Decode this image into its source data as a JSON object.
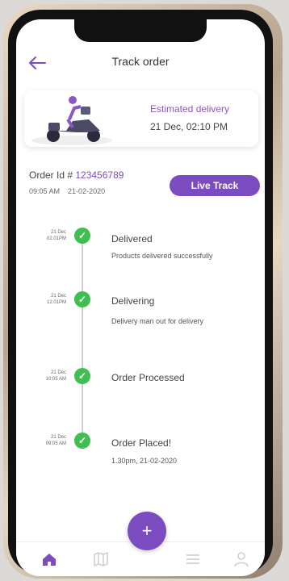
{
  "header": {
    "title": "Track order",
    "back_icon": "arrow-left-icon"
  },
  "estimate": {
    "label": "Estimated delivery",
    "datetime": "21 Dec,  02:10 PM"
  },
  "order": {
    "id_label": "Order Id # ",
    "id": "123456789",
    "time": "09:05 AM",
    "date": "21-02-2020",
    "live_track_label": "Live Track"
  },
  "timeline": [
    {
      "time": "21 Dec\n02.01PM",
      "title": "Delivered",
      "subtitle": "Products delivered successfully"
    },
    {
      "time": "21 Dec\n12.01PM",
      "title": "Delivering",
      "subtitle": "Delivery man out for delivery"
    },
    {
      "time": "21 Dec\n10:05 AM",
      "title": "Order Processed",
      "subtitle": ""
    },
    {
      "time": "21 Dec\n09:05 AM",
      "title": "Order Placed!",
      "subtitle": "1.30pm,   21-02-2020"
    }
  ],
  "fab": {
    "label": "+"
  },
  "nav": {
    "icons": [
      "home-icon",
      "map-icon",
      "menu-icon",
      "profile-icon"
    ]
  },
  "colors": {
    "accent": "#7a4cc0",
    "success": "#3fbf4f"
  }
}
